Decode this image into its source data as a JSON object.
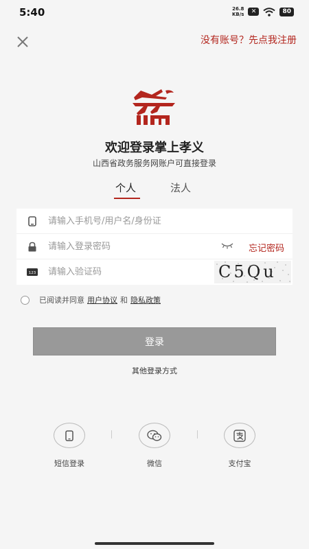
{
  "status_bar": {
    "time": "5:40",
    "net_speed_value": "26.8",
    "net_speed_unit": "KB/s",
    "battery": "80"
  },
  "header": {
    "register_text": "没有账号？先点我注册"
  },
  "welcome": {
    "title": "欢迎登录掌上孝义",
    "subtitle": "山西省政务服务网账户可直接登录"
  },
  "tabs": [
    {
      "label": "个人",
      "active": true
    },
    {
      "label": "法人",
      "active": false
    }
  ],
  "form": {
    "account_placeholder": "请输入手机号/用户名/身份证",
    "password_placeholder": "请输入登录密码",
    "forgot_password": "忘记密码",
    "captcha_placeholder": "请输入验证码",
    "captcha_text": "C5Qu"
  },
  "agreement": {
    "prefix": "已阅读并同意",
    "user_agreement": "用户协议",
    "and": "和",
    "privacy_policy": "隐私政策"
  },
  "login_button": "登录",
  "other_methods_label": "其他登录方式",
  "alt_logins": [
    {
      "label": "短信登录",
      "icon": "phone-icon"
    },
    {
      "label": "微信",
      "icon": "wechat-icon"
    },
    {
      "label": "支付宝",
      "icon": "alipay-icon"
    }
  ],
  "colors": {
    "accent": "#b3261e",
    "background": "#f5f5f5",
    "button_disabled": "#999999"
  }
}
